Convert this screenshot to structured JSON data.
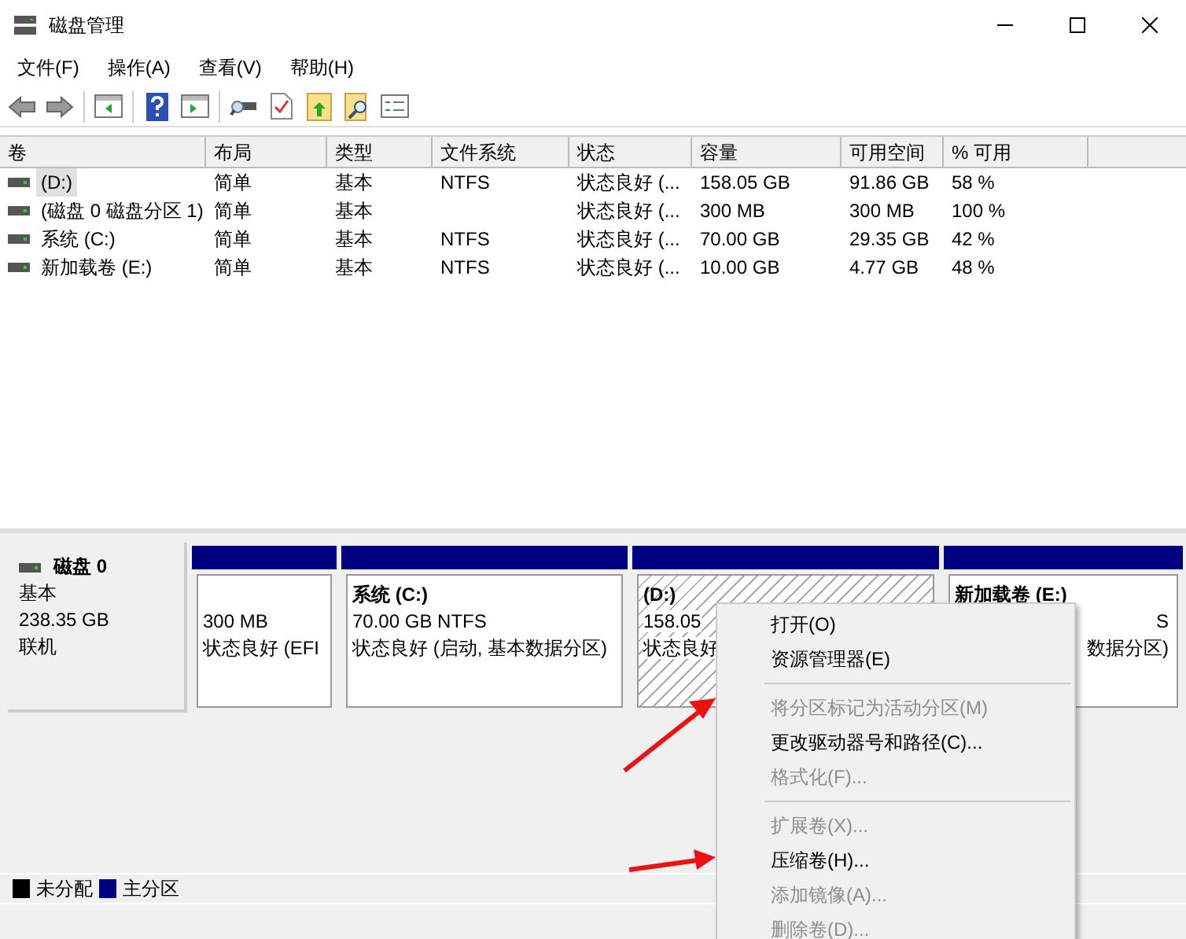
{
  "window": {
    "title": "磁盘管理"
  },
  "menu_bar": [
    "文件(F)",
    "操作(A)",
    "查看(V)",
    "帮助(H)"
  ],
  "table": {
    "columns": [
      "卷",
      "布局",
      "类型",
      "文件系统",
      "状态",
      "容量",
      "可用空间",
      "% 可用"
    ],
    "rows": [
      {
        "selected": true,
        "cells": [
          "(D:)",
          "简单",
          "基本",
          "NTFS",
          "状态良好 (...",
          "158.05 GB",
          "91.86 GB",
          "58 %"
        ]
      },
      {
        "selected": false,
        "cells": [
          "(磁盘 0 磁盘分区 1)",
          "简单",
          "基本",
          "",
          "状态良好 (...",
          "300 MB",
          "300 MB",
          "100 %"
        ]
      },
      {
        "selected": false,
        "cells": [
          "系统 (C:)",
          "简单",
          "基本",
          "NTFS",
          "状态良好 (...",
          "70.00 GB",
          "29.35 GB",
          "42 %"
        ]
      },
      {
        "selected": false,
        "cells": [
          "新加载卷 (E:)",
          "简单",
          "基本",
          "NTFS",
          "状态良好 (...",
          "10.00 GB",
          "4.77 GB",
          "48 %"
        ]
      }
    ]
  },
  "disk": {
    "name": "磁盘 0",
    "type": "基本",
    "size": "238.35 GB",
    "status": "联机",
    "partitions": [
      {
        "selected": false,
        "lines": [
          "300 MB",
          "状态良好 (EFI"
        ]
      },
      {
        "selected": false,
        "title": "系统 (C:)",
        "lines": [
          "70.00 GB NTFS",
          "状态良好 (启动, 基本数据分区)"
        ]
      },
      {
        "selected": true,
        "title": "(D:)",
        "lines": [
          "158.05",
          "状态良好"
        ]
      },
      {
        "selected": false,
        "title": "新加载卷 (E:)",
        "lines": [
          "S",
          "数据分区)"
        ]
      }
    ]
  },
  "legend": [
    {
      "label": "未分配",
      "color": "#000000"
    },
    {
      "label": "主分区",
      "color": "#000080"
    }
  ],
  "context_menu": [
    {
      "kind": "item",
      "label": "打开(O)",
      "disabled": false
    },
    {
      "kind": "item",
      "label": "资源管理器(E)",
      "disabled": false
    },
    {
      "kind": "separator"
    },
    {
      "kind": "item",
      "label": "将分区标记为活动分区(M)",
      "disabled": true
    },
    {
      "kind": "item",
      "label": "更改驱动器号和路径(C)...",
      "disabled": false
    },
    {
      "kind": "item",
      "label": "格式化(F)...",
      "disabled": true
    },
    {
      "kind": "separator"
    },
    {
      "kind": "item",
      "label": "扩展卷(X)...",
      "disabled": true
    },
    {
      "kind": "item",
      "label": "压缩卷(H)...",
      "disabled": false
    },
    {
      "kind": "item",
      "label": "添加镜像(A)...",
      "disabled": true
    },
    {
      "kind": "item",
      "label": "删除卷(D)...",
      "disabled": true
    }
  ]
}
